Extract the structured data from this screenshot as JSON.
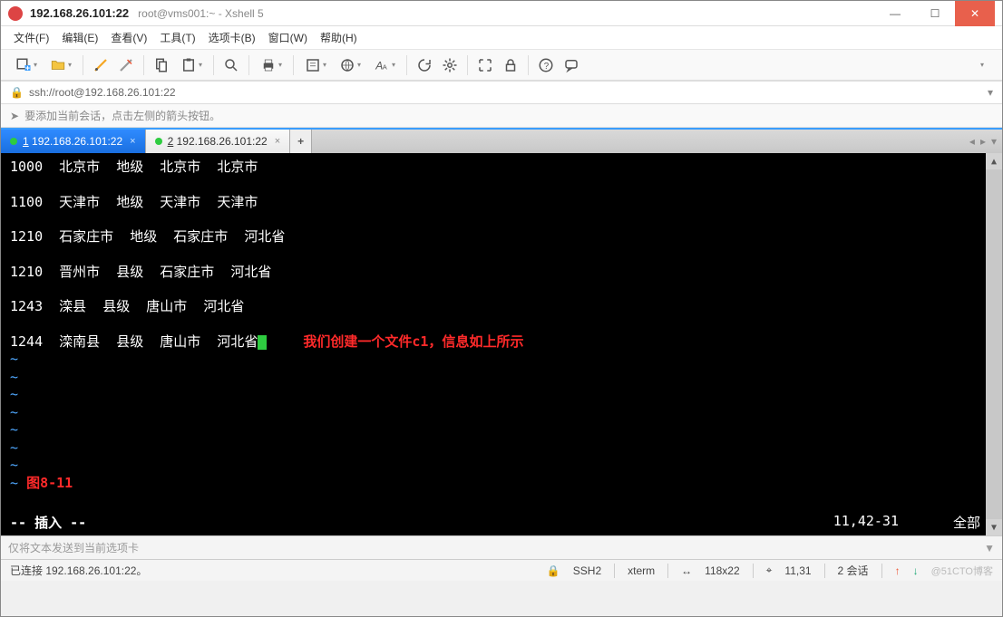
{
  "titlebar": {
    "main": "192.168.26.101:22",
    "sub": "root@vms001:~ - Xshell 5"
  },
  "menubar": {
    "file": "文件(F)",
    "edit": "编辑(E)",
    "view": "查看(V)",
    "tools": "工具(T)",
    "tabs": "选项卡(B)",
    "window": "窗口(W)",
    "help": "帮助(H)"
  },
  "addressbar": {
    "url": "ssh://root@192.168.26.101:22"
  },
  "hintbar": {
    "text": "要添加当前会话，点击左侧的箭头按钮。"
  },
  "tabs": [
    {
      "num": "1",
      "label": "192.168.26.101:22",
      "active": true
    },
    {
      "num": "2",
      "label": "192.168.26.101:22",
      "active": false
    }
  ],
  "terminal": {
    "lines": [
      "1000  北京市  地级  北京市  北京市",
      "",
      "1100  天津市  地级  天津市  天津市",
      "",
      "1210  石家庄市  地级  石家庄市  河北省",
      "",
      "1210  晋州市  县级  石家庄市  河北省",
      "",
      "1243  滦县  县级  唐山市  河北省",
      ""
    ],
    "last_line": "1244  滦南县  县级  唐山市  河北省",
    "annotation": "我们创建一个文件c1，信息如上所示",
    "figure_label": "图8-11",
    "mode": "-- 插入 --",
    "position": "11,42-31",
    "scope": "全部"
  },
  "sendbar": {
    "placeholder": "仅将文本发送到当前选项卡"
  },
  "statusbar": {
    "connected": "已连接 192.168.26.101:22。",
    "protocol": "SSH2",
    "term": "xterm",
    "size": "118x22",
    "cursor": "11,31",
    "sessions": "2 会话",
    "watermark": "@51CTO博客"
  }
}
